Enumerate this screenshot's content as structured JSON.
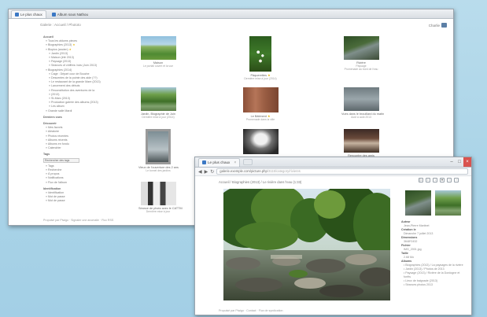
{
  "back_window": {
    "tabs": [
      "Le plus chaux",
      "Album sous Nathou"
    ],
    "breadcrumb": "Galerie : Accueil / Phototo",
    "account": "Charlie",
    "sidebar": {
      "section1_title": "Accueil",
      "section1_items": [
        {
          "label": "Tous les aldums pieces",
          "sub": false,
          "star": false
        },
        {
          "label": "Biographies (2013)",
          "sub": false,
          "star": true
        },
        {
          "label": "Biopics (ancien)",
          "sub": false,
          "star": true
        },
        {
          "label": "Jardin (2013)",
          "sub": true,
          "star": false
        },
        {
          "label": "Maison (été 2013)",
          "sub": true,
          "star": false
        },
        {
          "label": "Paysage (2013)",
          "sub": true,
          "star": false
        },
        {
          "label": "Séances of chiffres: bois (Juin 2013)",
          "sub": true,
          "star": false
        },
        {
          "label": "Biographies (2014)",
          "sub": false,
          "star": false
        },
        {
          "label": "Cage : Départ cour de Bouche",
          "sub": true,
          "star": false
        },
        {
          "label": "Descentes de la pointe des aide (??)",
          "sub": true,
          "star": false
        },
        {
          "label": "Le restaurant de la grande Mare (2013)",
          "sub": true,
          "star": false
        },
        {
          "label": "Lancement des débuts",
          "sub": true,
          "star": false
        },
        {
          "label": "Reconstitution des aventures de la",
          "sub": true,
          "star": false
        },
        {
          "label": "(2013)",
          "sub": true,
          "star": false
        },
        {
          "label": "St-Marc (2013)",
          "sub": true,
          "star": false
        },
        {
          "label": "Production galerie des albums (2013)",
          "sub": true,
          "star": false
        },
        {
          "label": "Les album",
          "sub": true,
          "star": false
        },
        {
          "label": "Grande salle Mardi",
          "sub": false,
          "star": false
        }
      ],
      "section2_title": "Derniers vues",
      "section3_title": "Découvrir",
      "section3_items": [
        "Mes favoris",
        "Aléatoire",
        "Photos récentes",
        "Albums récents",
        "Albums en fondu",
        "Calendrier"
      ],
      "section4_title": "Tags",
      "tags_select": "Rechercher des tags",
      "section4_items": [
        "Tags",
        "Recherche",
        "À propos",
        "Notifications",
        "Flux de l'album"
      ],
      "section5_title": "Identification",
      "section5_items": [
        "Identification",
        "Mot de passe",
        "Mot de passe"
      ]
    },
    "thumbnails": [
      {
        "caption": "Maison",
        "sub": "Le portail ouvert et la vue"
      },
      {
        "caption": "Pâquerettes",
        "sub": "Dernière mise à jour (2014)",
        "star": true
      },
      {
        "caption": "Rivière",
        "sub": "Paysage",
        "sub2": "Promenade au bord de l'eau"
      },
      {
        "caption": "Jardin, Biographie de Juin",
        "sub": "Dernière mise à jour (2014)"
      },
      {
        "caption": "Le Bâtiment",
        "sub": "Promenade dans la ville",
        "star": true
      },
      {
        "caption": "Vues dans le brouillard du matin",
        "sub": "Août à août 2013"
      },
      {
        "caption": "Vieux de l'ouverture des 2 ans",
        "sub": "Le tunnel des jardins"
      },
      {
        "caption": "Souvenirs",
        "sub": "Photos parents",
        "star": true
      },
      {
        "caption": "Rencontre des amis",
        "sub": "Dernière 2013"
      },
      {
        "caption": "Séance de photo avec le CATTM",
        "sub": "Dernière mise à jour"
      }
    ],
    "footer": "Propulsé par Piwigo · Signaler une anomalie · Flux RSS"
  },
  "front_window": {
    "tab_label": "Le plus chaux",
    "address": "galerie.exemple.com/picture.php",
    "address_tail": "/3115/category/rivieres",
    "title_path": "Accueil / Biographies (2013) / Le rivière dans l'eau (1:33)",
    "sidebar_info": [
      {
        "label": "Auteur",
        "value": "Jean-Pierre Martinet"
      },
      {
        "label": "Création le",
        "value": "Dimanche 7 juillet 2013"
      },
      {
        "label": "Dimensions",
        "value": "3648*2432"
      },
      {
        "label": "Fichier",
        "value": "IMG_2001.jpg"
      },
      {
        "label": "Taille",
        "value": "2.68 Mo"
      },
      {
        "label": "Albums",
        "value": ""
      }
    ],
    "albums_list": [
      "Biographies (2013) / La paysages de la rivière",
      "Jardin (2013) / Photos de 2013",
      "Paysage (2013) / Rivière de la Dordogne et forêts",
      "Lieux de baignade (2013)",
      "Séances photos 2013"
    ],
    "footer": "Propulsé par Piwigo · Contact · Flux de syndication"
  }
}
